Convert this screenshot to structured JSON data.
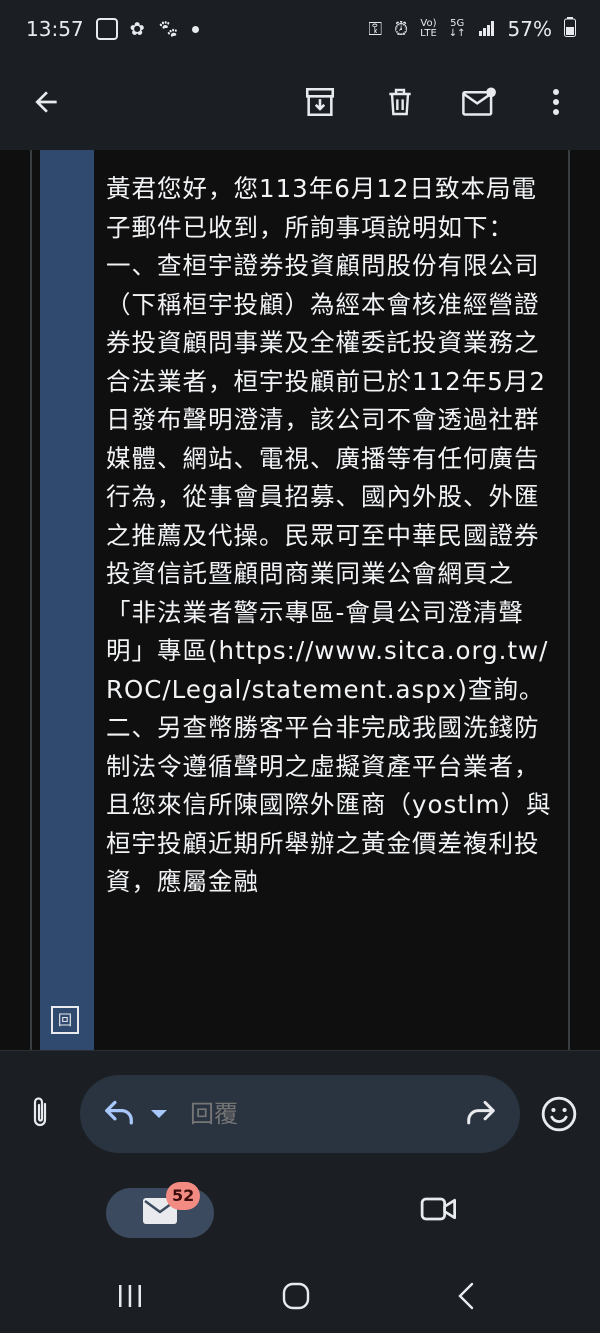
{
  "status_bar": {
    "time": "13:57",
    "battery": "57%",
    "network": "5G",
    "volte": "VoLTE"
  },
  "app_bar": {
    "icons": [
      "back-arrow-icon",
      "archive-icon",
      "delete-icon",
      "mark-unread-icon",
      "more-vert-icon"
    ]
  },
  "message": {
    "body": "黃君您好，您113年6月12日致本局電子郵件已收到，所詢事項說明如下： 一、查桓宇證券投資顧問股份有限公司（下稱桓宇投顧）為經本會核准經營證券投資顧問事業及全權委託投資業務之合法業者，桓宇投顧前已於112年5月2日發布聲明澄清，該公司不會透過社群媒體、網站、電視、廣播等有任何廣告行為，從事會員招募、國內外股、外匯之推薦及代操。民眾可至中華民國證券投資信託暨顧問商業同業公會網頁之「非法業者警示專區-會員公司澄清聲明」專區(https://www.sitca.org.tw/ROC/Legal/statement.aspx)查詢。 二、另查幣勝客平台非完成我國洗錢防制法令遵循聲明之虛擬資產平台業者，且您來信所陳國際外匯商（yostlm）與桓宇投顧近期所舉辦之黃金價差複利投資，應屬金融",
    "quote_marker": "回"
  },
  "composer": {
    "placeholder": "回覆"
  },
  "bottom_nav": {
    "mail_badge": "52"
  },
  "colors": {
    "background": "#1b1f23",
    "content_bg": "#0f0f10",
    "quote_bar": "#2f4a6e",
    "reply_pill": "#2a3340",
    "accent_blue": "#a8c7fa",
    "badge": "#f28b82"
  }
}
